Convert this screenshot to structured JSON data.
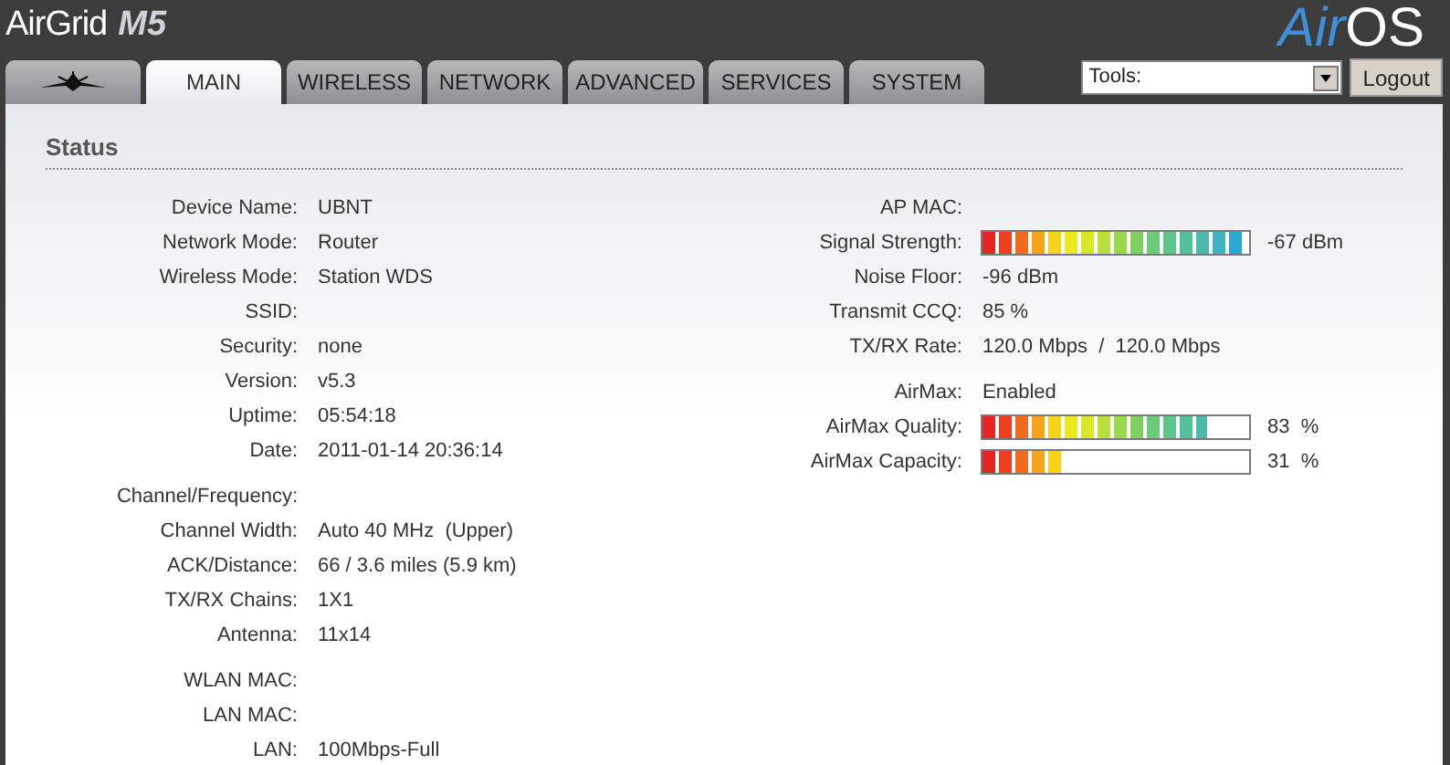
{
  "header": {
    "product": "AirGrid",
    "model": "M5",
    "os_logo": {
      "prefix": "Air",
      "suffix": "OS"
    }
  },
  "tabs": [
    {
      "kind": "logo",
      "selected": false
    },
    {
      "label": "MAIN",
      "selected": true
    },
    {
      "label": "WIRELESS",
      "selected": false
    },
    {
      "label": "NETWORK",
      "selected": false
    },
    {
      "label": "ADVANCED",
      "selected": false
    },
    {
      "label": "SERVICES",
      "selected": false
    },
    {
      "label": "SYSTEM",
      "selected": false
    }
  ],
  "tools": {
    "value": "Tools:"
  },
  "logout": "Logout",
  "status": {
    "title": "Status",
    "left": [
      [
        {
          "label": "Device Name:",
          "value": "UBNT"
        },
        {
          "label": "Network Mode:",
          "value": "Router"
        },
        {
          "label": "Wireless Mode:",
          "value": "Station WDS"
        },
        {
          "label": "SSID:"
        },
        {
          "label": "Security:",
          "value": "none"
        },
        {
          "label": "Version:",
          "value": "v5.3"
        },
        {
          "label": "Uptime:",
          "value": "05:54:18"
        },
        {
          "label": "Date:",
          "value": "2011-01-14 20:36:14"
        }
      ],
      [
        {
          "label": "Channel/Frequency:"
        },
        {
          "label": "Channel Width:",
          "value": "Auto 40 MHz  (Upper)"
        },
        {
          "label": "ACK/Distance:",
          "value": "66 / 3.6 miles (5.9 km)"
        },
        {
          "label": "TX/RX Chains:",
          "value": "1X1"
        },
        {
          "label": "Antenna:",
          "value": "11x14"
        }
      ],
      [
        {
          "label": "WLAN MAC:"
        },
        {
          "label": "LAN MAC:"
        },
        {
          "label": "LAN:",
          "value": "100Mbps-Full"
        }
      ]
    ],
    "right": [
      [
        {
          "kind": "text",
          "label": "AP MAC:"
        },
        {
          "kind": "meter",
          "label": "Signal Strength:",
          "level": 0.97,
          "reading": "-67 dBm"
        },
        {
          "kind": "text",
          "label": "Noise Floor:",
          "value": "-96 dBm"
        },
        {
          "kind": "text",
          "label": "Transmit CCQ:",
          "value": "85 %"
        },
        {
          "kind": "text",
          "label": "TX/RX Rate:",
          "value": "120.0 Mbps  /  120.0 Mbps"
        }
      ],
      [
        {
          "kind": "text",
          "label": "AirMax:",
          "value": "Enabled"
        },
        {
          "kind": "meter",
          "label": "AirMax Quality:",
          "level": 0.84,
          "reading": "83  %"
        },
        {
          "kind": "meter",
          "label": "AirMax Capacity:",
          "level": 0.31,
          "reading": "31  %"
        }
      ]
    ]
  }
}
